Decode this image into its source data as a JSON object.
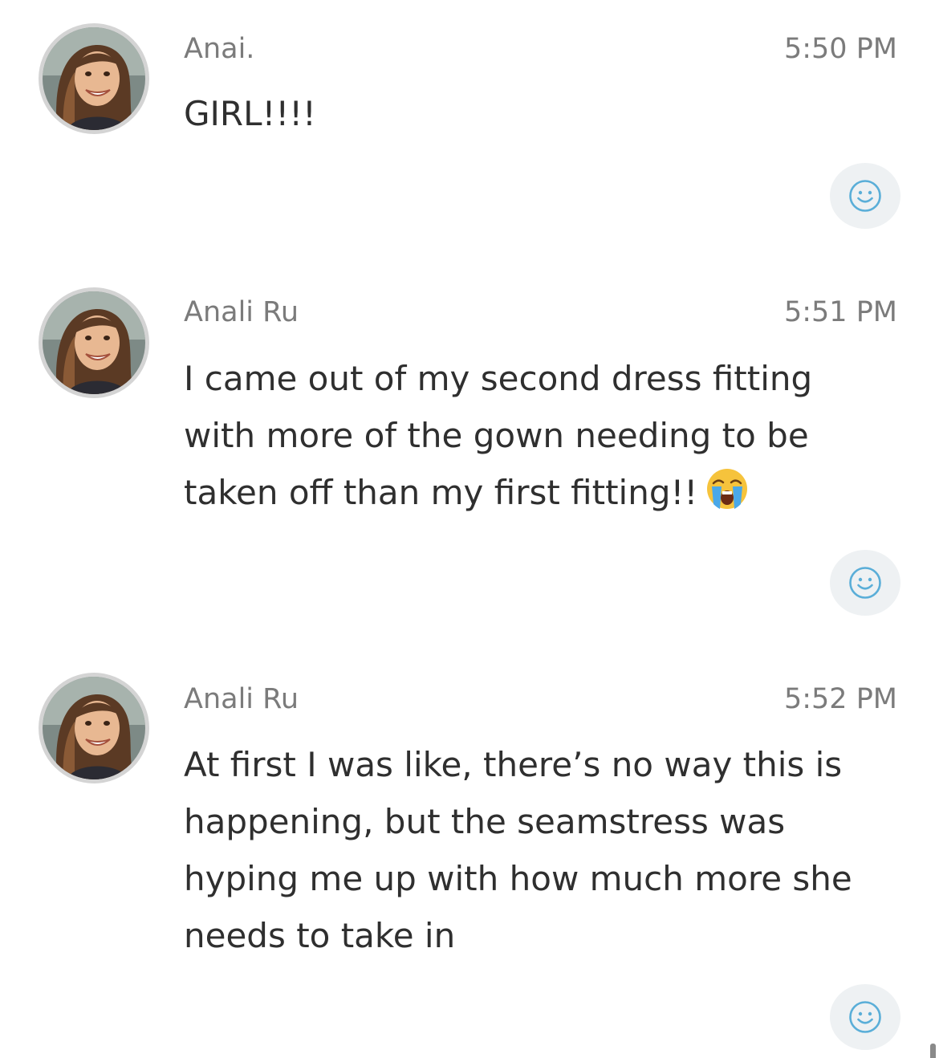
{
  "messages": [
    {
      "sender": "Anai.",
      "time": "5:50 PM",
      "text": "GIRL!!!!",
      "emoji": null
    },
    {
      "sender": "Anali Ru",
      "time": "5:51 PM",
      "text": "I came out of my second dress fitting with more of the gown needing to be taken off than my first fitting!!",
      "emoji": "crying-face"
    },
    {
      "sender": "Anali Ru",
      "time": "5:52 PM",
      "text": "At first I was like, there’s no way this is happening, but the seamstress was hyping me up with how much more she needs to take in",
      "emoji": null
    }
  ],
  "icons": {
    "avatar": "avatar-photo",
    "react": "smiley-icon",
    "emoji": "loudly-crying-face-emoji"
  },
  "colors": {
    "react_icon": "#5aaed8",
    "react_bg": "#eef1f3",
    "meta_text": "#7b7b7b",
    "body_text": "#2f2f2f"
  }
}
